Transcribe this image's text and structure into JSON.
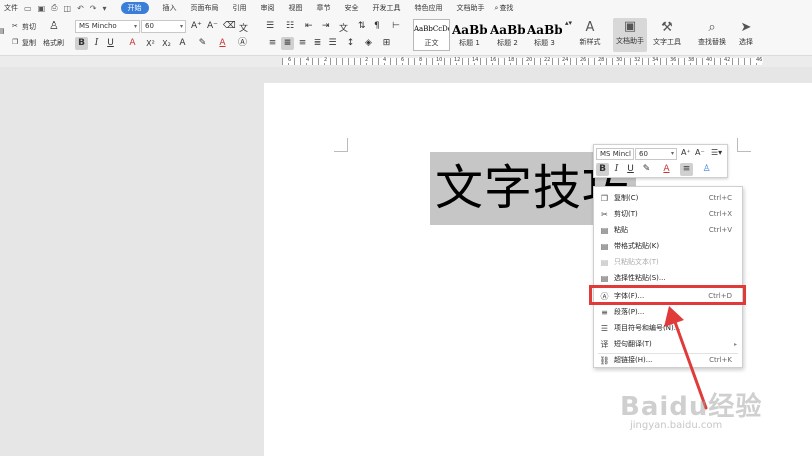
{
  "menubar": {
    "file": "文件",
    "tabs": [
      {
        "label": "开始",
        "active": true
      },
      {
        "label": "插入"
      },
      {
        "label": "页面布局"
      },
      {
        "label": "引用"
      },
      {
        "label": "审阅"
      },
      {
        "label": "视图"
      },
      {
        "label": "章节"
      },
      {
        "label": "安全"
      },
      {
        "label": "开发工具"
      },
      {
        "label": "特色应用"
      },
      {
        "label": "文档助手"
      },
      {
        "label": "查找"
      }
    ],
    "accent": "#3b7ed8"
  },
  "ribbon": {
    "cut": "剪切",
    "copy": "复制",
    "format_painter": "格式刷",
    "font_name": "MS Mincho",
    "font_size": "60",
    "styles": [
      {
        "preview": "AaBbCcDd",
        "name": "正文"
      },
      {
        "preview": "AaBb",
        "name": "标题 1"
      },
      {
        "preview": "AaBb(",
        "name": "标题 2"
      },
      {
        "preview": "AaBbC",
        "name": "标题 3"
      }
    ],
    "new_style": "新样式",
    "doc_assistant": "文档助手",
    "text_tools": "文字工具",
    "find_replace": "查找替换",
    "select": "选择"
  },
  "ruler": {
    "labels": [
      "6",
      "4",
      "2",
      "2",
      "4",
      "6",
      "8",
      "10",
      "12",
      "14",
      "16",
      "18",
      "20",
      "22",
      "24",
      "26",
      "28",
      "30",
      "32",
      "34",
      "36",
      "38",
      "40",
      "42",
      "46"
    ]
  },
  "document": {
    "text": "文字技巧"
  },
  "mini_toolbar": {
    "font_name": "MS Mincl",
    "font_size": "60"
  },
  "context_menu": {
    "items": [
      {
        "icon": "copy-icon",
        "label": "复制(C)",
        "shortcut": "Ctrl+C"
      },
      {
        "icon": "cut-icon",
        "label": "剪切(T)",
        "shortcut": "Ctrl+X"
      },
      {
        "icon": "paste-icon",
        "label": "粘贴",
        "shortcut": "Ctrl+V"
      },
      {
        "icon": "paste-keep-format-icon",
        "label": "带格式粘贴(K)",
        "shortcut": ""
      },
      {
        "icon": "paste-text-icon",
        "label": "只粘贴文本(T)",
        "shortcut": ""
      },
      {
        "icon": "paste-special-icon",
        "label": "选择性粘贴(S)...",
        "shortcut": ""
      },
      {
        "icon": "font-icon",
        "label": "字体(F)...",
        "shortcut": "Ctrl+D"
      },
      {
        "icon": "paragraph-icon",
        "label": "段落(P)...",
        "shortcut": ""
      },
      {
        "icon": "bullets-icon",
        "label": "项目符号和编号(N)...",
        "shortcut": ""
      },
      {
        "icon": "translate-icon",
        "label": "短句翻译(T)",
        "shortcut": ""
      },
      {
        "icon": "hyperlink-icon",
        "label": "超链接(H)...",
        "shortcut": "Ctrl+K"
      }
    ],
    "highlight_color": "#e03a3a"
  },
  "watermark": {
    "line1": "Baidu经验",
    "line2": "jingyan.baidu.com"
  }
}
